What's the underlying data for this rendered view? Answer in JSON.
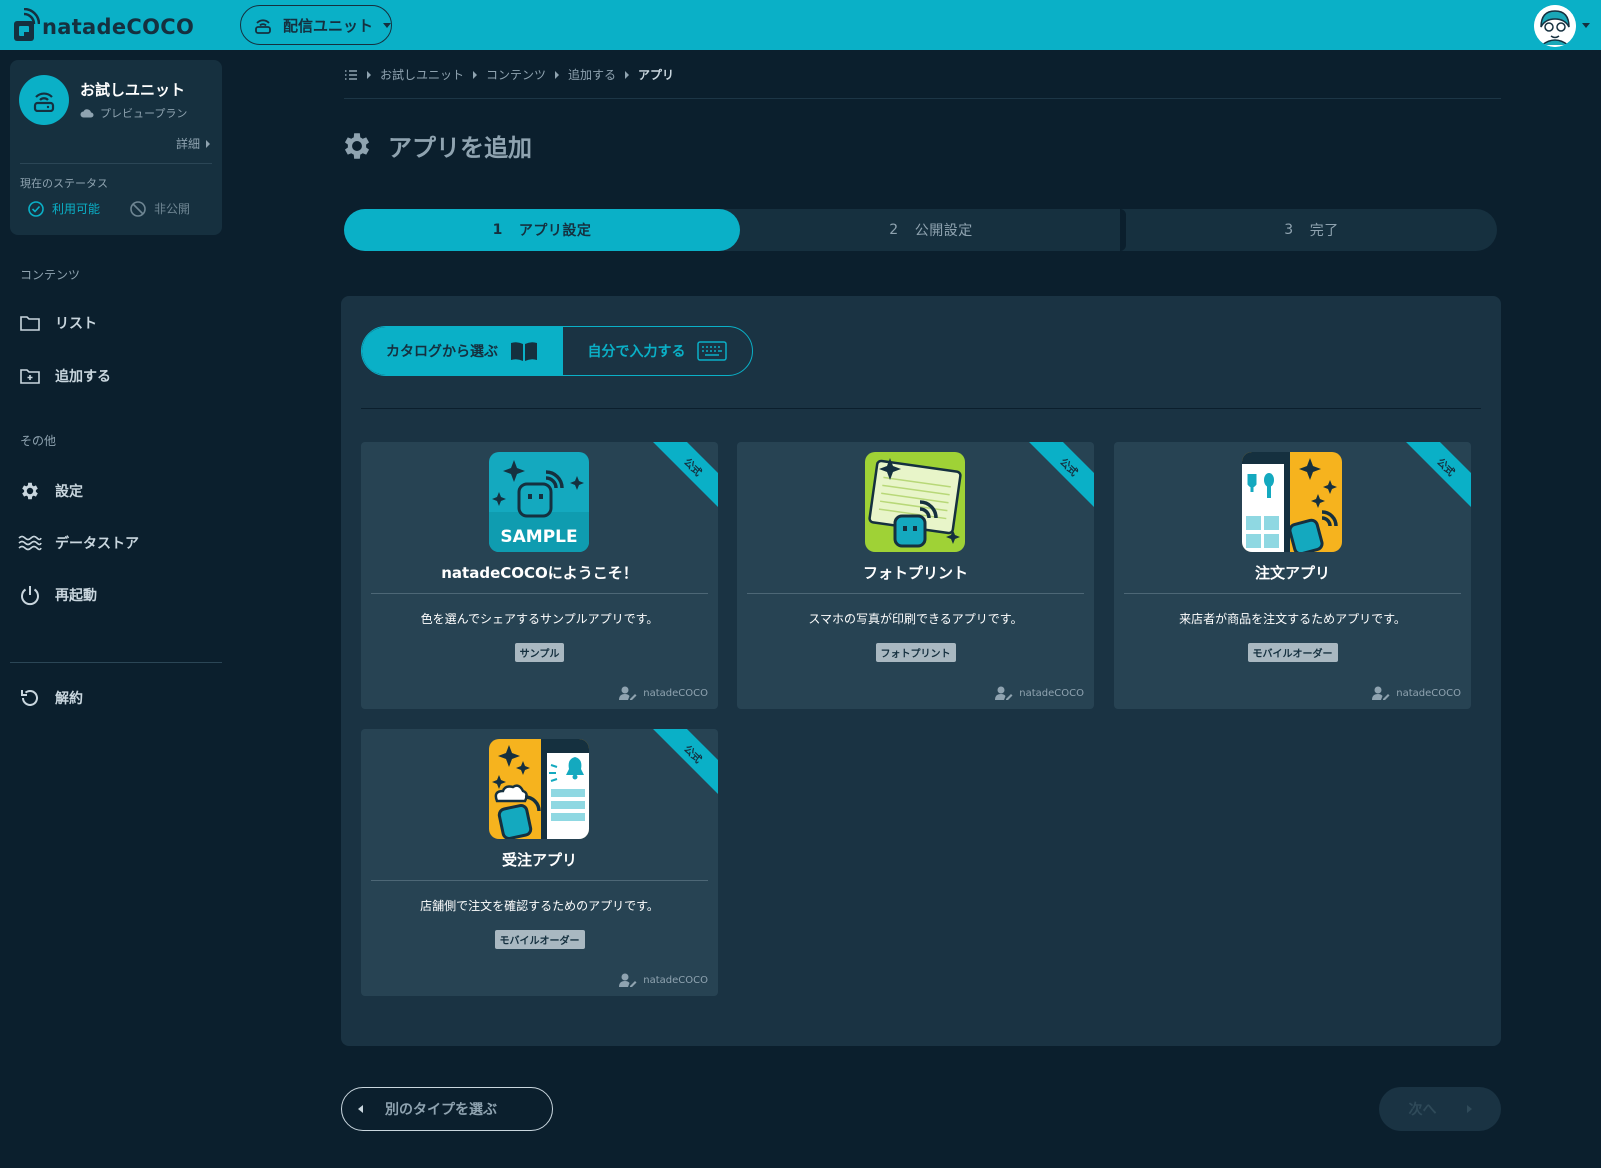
{
  "header": {
    "logo_text": "natadeCOCO",
    "unit_select": "配信ユニット"
  },
  "sidebar": {
    "unit": {
      "name": "お試しユニット",
      "plan": "プレビュープラン",
      "detail": "詳細",
      "status_label": "現在のステータス",
      "status_available": "利用可能",
      "status_private": "非公開"
    },
    "sections": {
      "contents": "コンテンツ",
      "other": "その他"
    },
    "items": [
      {
        "label": "リスト",
        "icon": "folder-icon"
      },
      {
        "label": "追加する",
        "icon": "folder-plus-icon"
      },
      {
        "label": "設定",
        "icon": "gear-icon"
      },
      {
        "label": "データストア",
        "icon": "waves-icon"
      },
      {
        "label": "再起動",
        "icon": "power-icon"
      },
      {
        "label": "解約",
        "icon": "undo-icon"
      }
    ]
  },
  "breadcrumb": [
    "お試しユニット",
    "コンテンツ",
    "追加する",
    "アプリ"
  ],
  "page": {
    "title": "アプリを追加"
  },
  "steps": [
    {
      "num": "1",
      "label": "アプリ設定"
    },
    {
      "num": "2",
      "label": "公開設定"
    },
    {
      "num": "3",
      "label": "完了"
    }
  ],
  "toggle": {
    "catalog": "カタログから選ぶ",
    "manual": "自分で入力する"
  },
  "apps": [
    {
      "name": "natadeCOCOにようこそ！",
      "desc": "色を選んでシェアするサンプルアプリです。",
      "tag": "サンプル",
      "author": "natadeCOCO",
      "ribbon": "公式",
      "icon_text": "SAMPLE"
    },
    {
      "name": "フォトプリント",
      "desc": "スマホの写真が印刷できるアプリです。",
      "tag": "フォトプリント",
      "author": "natadeCOCO",
      "ribbon": "公式"
    },
    {
      "name": "注文アプリ",
      "desc": "来店者が商品を注文するためアプリです。",
      "tag": "モバイルオーダー",
      "author": "natadeCOCO",
      "ribbon": "公式"
    },
    {
      "name": "受注アプリ",
      "desc": "店舗側で注文を確認するためのアプリです。",
      "tag": "モバイルオーダー",
      "author": "natadeCOCO",
      "ribbon": "公式"
    }
  ],
  "footer": {
    "back": "別のタイプを選ぶ",
    "next": "次へ"
  },
  "colors": {
    "accent": "#0ab0c7",
    "background": "#0b1f2d",
    "panel": "#1a3343",
    "card": "#274353"
  }
}
